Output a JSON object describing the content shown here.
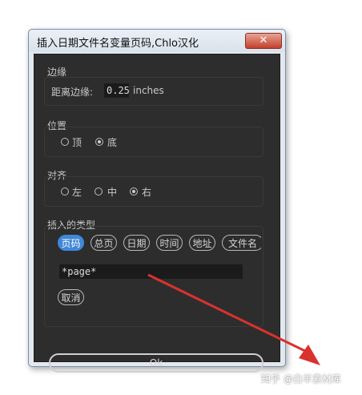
{
  "window": {
    "title": "插入日期文件名变量页码,Chlo汉化",
    "close_glyph": "✕"
  },
  "margin_section": {
    "label": "边缘",
    "distance_label": "距离边缘:",
    "distance_value": "0.25",
    "unit": "inches"
  },
  "position_section": {
    "label": "位置",
    "options": [
      {
        "label": "顶",
        "selected": false
      },
      {
        "label": "底",
        "selected": true
      }
    ]
  },
  "align_section": {
    "label": "对齐",
    "options": [
      {
        "label": "左",
        "selected": false
      },
      {
        "label": "中",
        "selected": false
      },
      {
        "label": "右",
        "selected": true
      }
    ]
  },
  "insert_section": {
    "label": "插入的类型",
    "types": [
      {
        "label": "页码",
        "active": true
      },
      {
        "label": "总页",
        "active": false
      },
      {
        "label": "日期",
        "active": false
      },
      {
        "label": "时间",
        "active": false
      },
      {
        "label": "地址",
        "active": false
      },
      {
        "label": "文件名",
        "active": false
      }
    ],
    "field_value": "*page*",
    "cancel_label": "取消"
  },
  "ok_label": "Ok",
  "watermark": "知乎 @白羊素材库",
  "colors": {
    "active_pill": "#3f88d8",
    "arrow": "#d9322e",
    "panel_bg": "#2d2d2d"
  }
}
